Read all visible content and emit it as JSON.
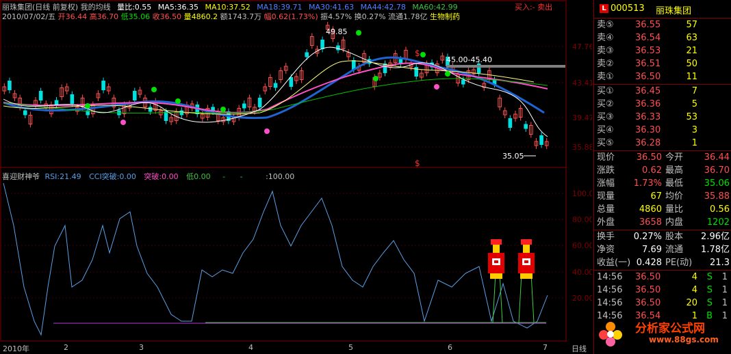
{
  "stock_header": {
    "name": "丽珠集团(日线 前复权)",
    "formula": "我的均线",
    "vol_ratio": "量比:0.55",
    "ma5": "MA5:36.35",
    "ma10": "MA10:37.52",
    "ma18": "MA18:39.71",
    "ma30": "MA30:41.63",
    "ma44": "MA44:42.78",
    "ma60": "MA60:42.99",
    "buy_sell": "买入:- 卖出"
  },
  "day_info": {
    "date": "2010/07/02/五",
    "open": "开36.44",
    "high": "高36.70",
    "low": "低35.06",
    "close": "收36.50",
    "volume": "量4860.2",
    "amount": "额1743.7万",
    "change": "幅0.62(1.73%)",
    "amplitude": "振4.57%",
    "turnover": "换0.27%",
    "float": "流通1.78亿",
    "sector": "生物制药"
  },
  "price_axis": [
    "47.76",
    "43.41",
    "39.47",
    "35.88"
  ],
  "price_annotations": {
    "high_mark": "49.85",
    "range": "45.00-45.40",
    "low_mark": "35.05",
    "dollar": "$"
  },
  "indicator_header": {
    "name": "喜迎财神爷",
    "rsi": "RSI:21.49",
    "cci": "CCI突破:0.00",
    "tupo": "突破:0.00",
    "di": "低0.00",
    "dash1": "-",
    "dash2": "-",
    "hundred": ":100.00"
  },
  "indicator_axis": [
    "100.00",
    "80.00",
    "60.00",
    "40.00",
    "20.00"
  ],
  "x_axis": {
    "year": "2010年",
    "months": [
      "2",
      "3",
      "4",
      "5",
      "6",
      "7"
    ],
    "period": "日线"
  },
  "quote_panel": {
    "code": "000513",
    "name": "丽珠集团",
    "logo": "L",
    "asks": [
      {
        "label": "卖⑤",
        "price": "36.55",
        "vol": "57"
      },
      {
        "label": "卖④",
        "price": "36.54",
        "vol": "63"
      },
      {
        "label": "卖③",
        "price": "36.53",
        "vol": "21"
      },
      {
        "label": "卖②",
        "price": "36.51",
        "vol": "50"
      },
      {
        "label": "卖①",
        "price": "36.50",
        "vol": "11"
      }
    ],
    "bids": [
      {
        "label": "买①",
        "price": "36.45",
        "vol": "7"
      },
      {
        "label": "买②",
        "price": "36.36",
        "vol": "5"
      },
      {
        "label": "买③",
        "price": "36.33",
        "vol": "53"
      },
      {
        "label": "买④",
        "price": "36.30",
        "vol": "3"
      },
      {
        "label": "买⑤",
        "price": "36.28",
        "vol": "1"
      }
    ],
    "stats": [
      {
        "l1": "现价",
        "v1": "36.50",
        "l2": "今开",
        "v2": "36.44"
      },
      {
        "l1": "涨跌",
        "v1": "0.62",
        "l2": "最高",
        "v2": "36.70"
      },
      {
        "l1": "涨幅",
        "v1": "1.73%",
        "l2": "最低",
        "v2": "35.06"
      },
      {
        "l1": "现量",
        "v1": "67",
        "l2": "均价",
        "v2": "35.88"
      },
      {
        "l1": "总量",
        "v1": "4860",
        "l2": "量比",
        "v2": "0.56"
      },
      {
        "l1": "外盘",
        "v1": "3658",
        "l2": "内盘",
        "v2": "1202"
      }
    ],
    "finance": [
      {
        "l1": "换手",
        "v1": "0.27%",
        "l2": "股本",
        "v2": "2.96亿"
      },
      {
        "l1": "净资",
        "v1": "7.69",
        "l2": "流通",
        "v2": "1.78亿"
      },
      {
        "l1": "收益(一)",
        "v1": "0.428",
        "l2": "PE(动)",
        "v2": "21.3"
      }
    ],
    "ticks": [
      {
        "time": "14:56",
        "price": "36.50",
        "vol": "4",
        "side": "S",
        "n": "1"
      },
      {
        "time": "14:56",
        "price": "36.50",
        "vol": "4",
        "side": "S",
        "n": "1"
      },
      {
        "time": "14:56",
        "price": "36.50",
        "vol": "20",
        "side": "S",
        "n": "1"
      },
      {
        "time": "14:56",
        "price": "36.54",
        "vol": "1",
        "side": "B",
        "n": "1"
      }
    ]
  },
  "watermark": {
    "text": "分析家公式网",
    "url": "www.88gs.com"
  },
  "colors": {
    "up": "#ff5050",
    "down": "#00e0e0",
    "yellow": "#ffff00",
    "grid": "#800000",
    "ma_blue": "#1e64d2",
    "ma_pink": "#ff50c8",
    "ma_green": "#00c000",
    "rsi": "#5aa0e6"
  }
}
